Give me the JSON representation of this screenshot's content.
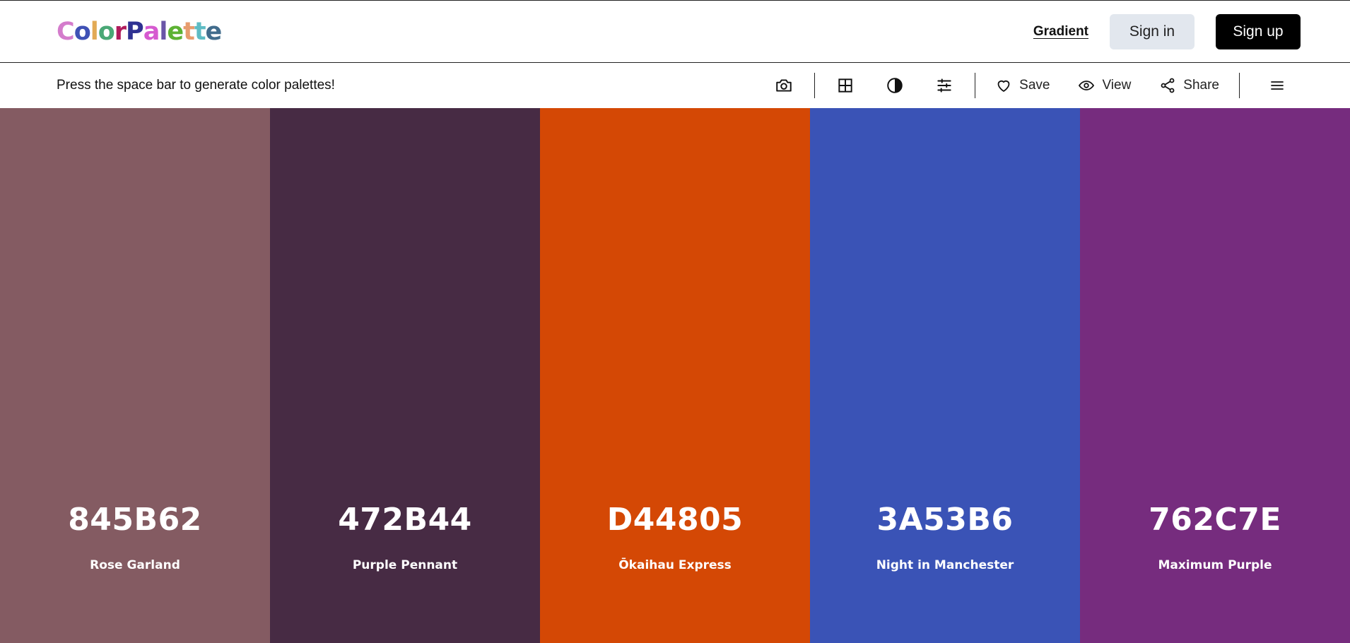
{
  "header": {
    "logo": [
      {
        "char": "C",
        "color": "#d47ccc"
      },
      {
        "char": "o",
        "color": "#3f51b5"
      },
      {
        "char": "l",
        "color": "#e2aa55"
      },
      {
        "char": "o",
        "color": "#4aa876"
      },
      {
        "char": "r",
        "color": "#b01b5c"
      },
      {
        "char": "P",
        "color": "#2e3192"
      },
      {
        "char": "a",
        "color": "#d65ad0"
      },
      {
        "char": "l",
        "color": "#6a55a8"
      },
      {
        "char": "e",
        "color": "#5db234"
      },
      {
        "char": "t",
        "color": "#e79c6e"
      },
      {
        "char": "t",
        "color": "#5ebcc4"
      },
      {
        "char": "e",
        "color": "#416c8c"
      }
    ],
    "gradient_label": "Gradient",
    "signin_label": "Sign in",
    "signup_label": "Sign up"
  },
  "toolbar": {
    "hint": "Press the space bar to generate color palettes!",
    "icons": [
      "camera-icon",
      "grid-icon",
      "contrast-icon",
      "sliders-icon"
    ],
    "save_label": "Save",
    "view_label": "View",
    "share_label": "Share"
  },
  "palette": [
    {
      "hex": "845B62",
      "name": "Rose Garland",
      "color": "#845B62"
    },
    {
      "hex": "472B44",
      "name": "Purple Pennant",
      "color": "#472B44"
    },
    {
      "hex": "D44805",
      "name": "Ōkaihau Express",
      "color": "#D44805"
    },
    {
      "hex": "3A53B6",
      "name": "Night in Manchester",
      "color": "#3A53B6"
    },
    {
      "hex": "762C7E",
      "name": "Maximum Purple",
      "color": "#762C7E"
    }
  ]
}
